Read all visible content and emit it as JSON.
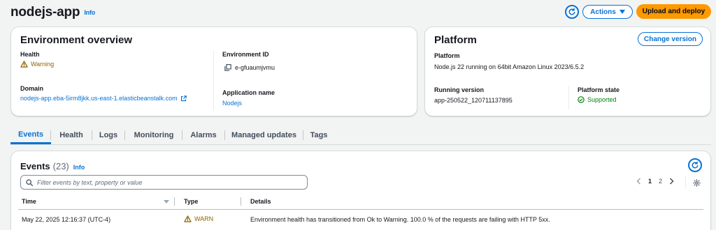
{
  "header": {
    "title": "nodejs-app",
    "info": "Info",
    "actions_label": "Actions",
    "upload_label": "Upload and deploy"
  },
  "overview": {
    "title": "Environment overview",
    "health_label": "Health",
    "health_value": "Warning",
    "domain_label": "Domain",
    "domain_value": "nodejs-app.eba-5irm8jkk.us-east-1.elasticbeanstalk.com",
    "env_id_label": "Environment ID",
    "env_id_value": "e-gfuaumjvmu",
    "app_name_label": "Application name",
    "app_name_value": "Nodejs"
  },
  "platform": {
    "title": "Platform",
    "change_label": "Change version",
    "platform_label": "Platform",
    "platform_value": "Node.js 22 running on 64bit Amazon Linux 2023/6.5.2",
    "running_label": "Running version",
    "running_value": "app-250522_120711137895",
    "state_label": "Platform state",
    "state_value": "Supported"
  },
  "tabs": [
    "Events",
    "Health",
    "Logs",
    "Monitoring",
    "Alarms",
    "Managed updates",
    "Tags"
  ],
  "events": {
    "title": "Events",
    "count": "(23)",
    "info": "Info",
    "search_placeholder": "Filter events by text, property or value",
    "pages": [
      "1",
      "2"
    ],
    "columns": {
      "time": "Time",
      "type": "Type",
      "details": "Details"
    },
    "rows": [
      {
        "time": "May 22, 2025 12:16:37 (UTC-4)",
        "type": "WARN",
        "details": "Environment health has transitioned from Ok to Warning. 100.0 % of the requests are failing with HTTP 5xx."
      }
    ]
  },
  "colors": {
    "accent": "#0972d3",
    "warning": "#8d6605",
    "success": "#037f0c",
    "primary_button": "#ff9900"
  }
}
